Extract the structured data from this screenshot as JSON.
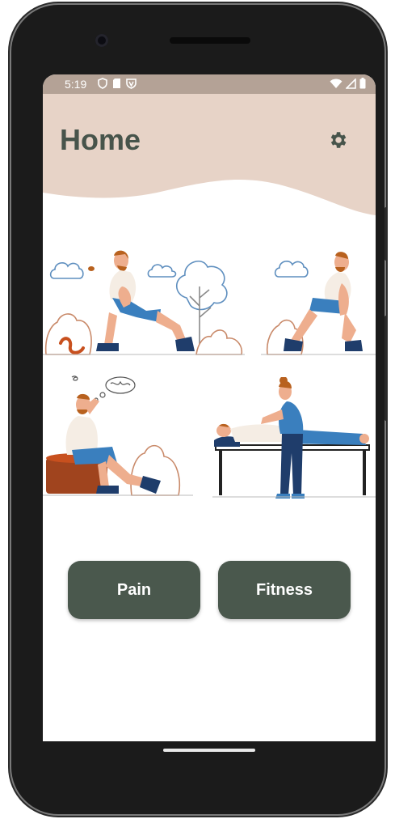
{
  "status_bar": {
    "time": "5:19",
    "left_icons": [
      "shield-icon",
      "sd-card-icon",
      "vpn-icon"
    ],
    "right_icons": [
      "wifi-icon",
      "signal-icon",
      "battery-icon"
    ]
  },
  "header": {
    "title": "Home",
    "settings_icon": "gear-icon",
    "background_color": "#e7d3c7"
  },
  "illustrations": [
    {
      "name": "man kneeling holding knee outdoors"
    },
    {
      "name": "man kneeling holding ankle"
    },
    {
      "name": "man sitting on log holding head"
    },
    {
      "name": "physiotherapist massaging patient on table"
    }
  ],
  "buttons": {
    "pain_label": "Pain",
    "fitness_label": "Fitness"
  },
  "colors": {
    "accent": "#4a584d",
    "status_bar": "#b4a296",
    "title": "#47544b"
  }
}
